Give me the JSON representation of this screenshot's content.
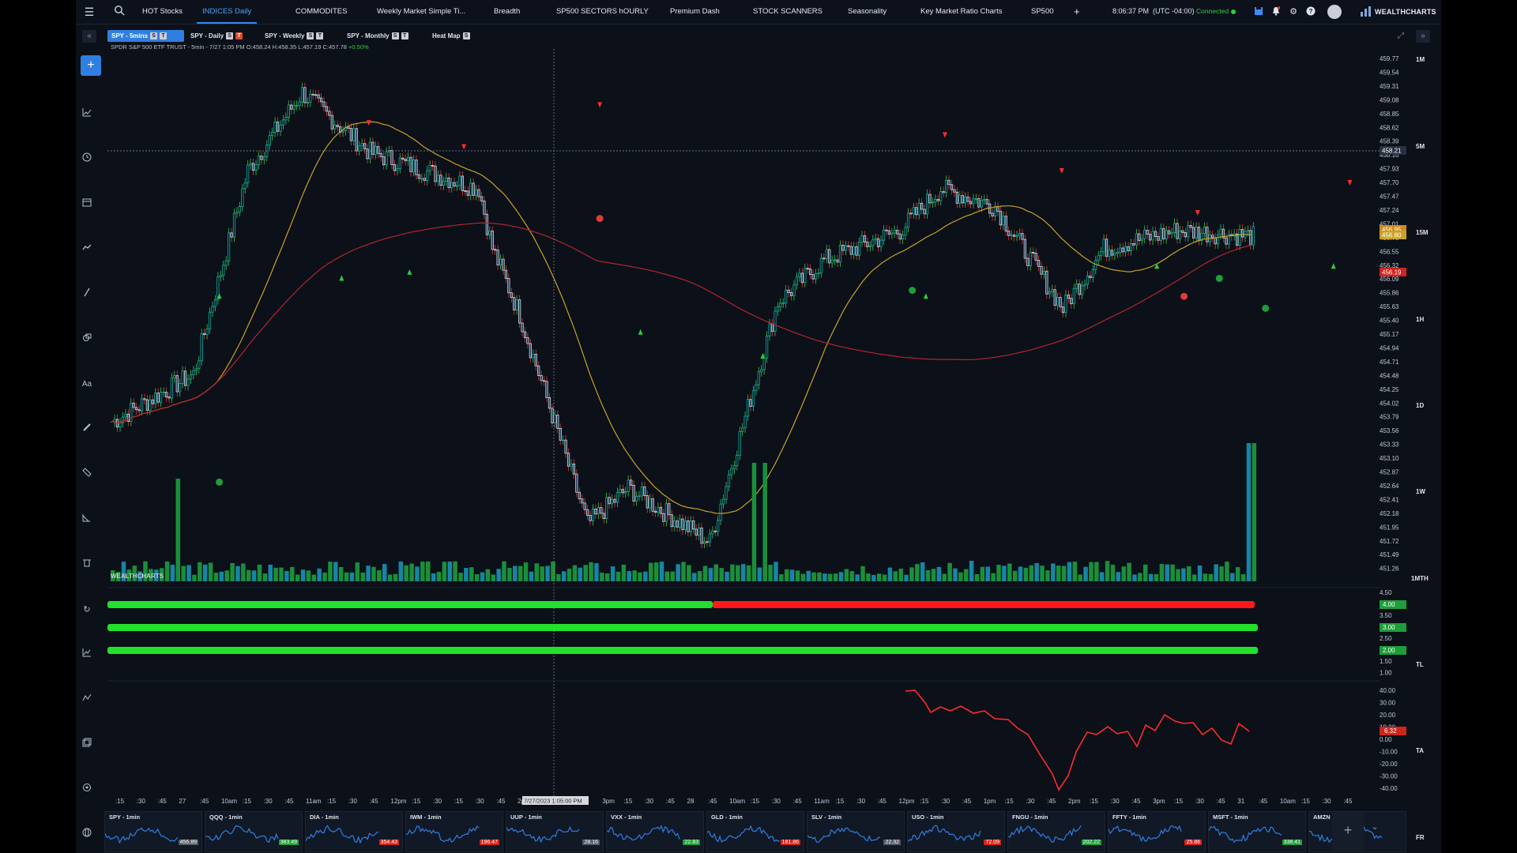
{
  "nav": {
    "tabs": [
      "HOT Stocks",
      "INDICES Daily",
      "COMMODITES",
      "Weekly Market Simple Ti...",
      "Breadth",
      "SP500 SECTORS hOURLY",
      "Premium Dash",
      "STOCK SCANNERS",
      "Seasonality",
      "Key Market Ratio Charts",
      "SP500"
    ],
    "active_tab": "INDICES Daily",
    "add_label": "+",
    "time": "8:06:37 PM",
    "timezone": "(UTC -04:00)",
    "status": "Connected",
    "brand": "WEALTHCHARTS"
  },
  "chart_tabs": [
    {
      "label": "SPY - 5mins",
      "badges": [
        "S",
        "T"
      ],
      "active": true
    },
    {
      "label": "SPY - Daily",
      "badges": [
        "S",
        "T"
      ],
      "active": false
    },
    {
      "label": "SPY - Weekly",
      "badges": [
        "S",
        "T"
      ],
      "active": false
    },
    {
      "label": "SPY - Monthly",
      "badges": [
        "S",
        "T"
      ],
      "active": false
    },
    {
      "label": "Heat Map",
      "badges": [
        "S"
      ],
      "active": false
    }
  ],
  "symbol": {
    "name": "SPDR S&P 500 ETF TRUST",
    "bar_info": "- 5min - 7/27 1:05 PM O:458.24 H:458.35 L:457.19 C:457.78",
    "change": "+0.50%"
  },
  "timeframes": [
    "1M",
    "5M",
    "15M",
    "1H",
    "1D",
    "1W",
    "1MTH",
    "TL",
    "TA",
    "FR"
  ],
  "price_axis": [
    "459.77",
    "459.54",
    "459.31",
    "459.08",
    "458.85",
    "458.62",
    "458.39",
    "458.16",
    "457.93",
    "457.70",
    "457.47",
    "457.24",
    "457.01",
    "456.78",
    "456.55",
    "456.32",
    "456.09",
    "455.86",
    "455.63",
    "455.40",
    "455.17",
    "454.94",
    "454.71",
    "454.48",
    "454.25",
    "454.02",
    "453.79",
    "453.56",
    "453.33",
    "453.10",
    "452.87",
    "452.64",
    "452.41",
    "452.18",
    "451.95",
    "451.72",
    "451.49",
    "451.26"
  ],
  "price_tags": {
    "crosshair": "458.21",
    "ma1": "456.95",
    "ma2": "456.80",
    "last": "456.19"
  },
  "indicator1_axis": [
    "4.50",
    "4.00",
    "3.50",
    "3.00",
    "2.50",
    "2.00",
    "1.50",
    "1.00"
  ],
  "indicator1_tags": [
    "4.00",
    "3.00",
    "2.00"
  ],
  "indicator2_axis": [
    "40.00",
    "30.00",
    "20.00",
    "10.00",
    "0.00",
    "-10.00",
    "-20.00",
    "-30.00",
    "-40.00"
  ],
  "indicator2_tag": "6.32",
  "time_axis": [
    ":15",
    ":30",
    ":45",
    "27",
    ":45",
    "10am",
    ":15",
    ":30",
    ":45",
    "11am",
    ":15",
    ":30",
    ":45",
    "12pm",
    ":15",
    ":30",
    ":15",
    ":30",
    ":45",
    "2pm",
    ":15",
    ":30",
    ":45",
    "3pm",
    ":15",
    ":30",
    ":45",
    "28",
    ":45",
    "10am",
    ":15",
    ":30",
    ":45",
    "11am",
    ":15",
    ":30",
    ":45",
    "12pm",
    ":15",
    ":30",
    ":45",
    "1pm",
    ":15",
    ":30",
    ":45",
    "2pm",
    ":15",
    ":30",
    ":45",
    "3pm",
    ":15",
    ":30",
    ":45",
    "31",
    ":45",
    "10am",
    ":15",
    ":30",
    ":45"
  ],
  "crosshair_time": "7/27/2023 1:05:00 PM",
  "watermark": "WEALTHCHARTS",
  "mini_charts": [
    {
      "title": "SPY - 1min",
      "price": "456.89",
      "color": "#555b66"
    },
    {
      "title": "QQQ - 1min",
      "price": "383.49",
      "color": "#1e9e3a"
    },
    {
      "title": "DIA - 1min",
      "price": "354.43",
      "color": "#d0241c"
    },
    {
      "title": "IWM - 1min",
      "price": "196.47",
      "color": "#d0241c"
    },
    {
      "title": "UUP - 1min",
      "price": "28.16",
      "color": "#555b66"
    },
    {
      "title": "VXX - 1min",
      "price": "22.83",
      "color": "#1e9e3a"
    },
    {
      "title": "GLD - 1min",
      "price": "181.86",
      "color": "#d0241c"
    },
    {
      "title": "SLV - 1min",
      "price": "22.32",
      "color": "#555b66"
    },
    {
      "title": "USO - 1min",
      "price": "72.09",
      "color": "#d0241c"
    },
    {
      "title": "FNGU - 1min",
      "price": "202.22",
      "color": "#1e9e3a"
    },
    {
      "title": "FFTY - 1min",
      "price": "25.86",
      "color": "#d0241c"
    },
    {
      "title": "MSFT - 1min",
      "price": "338.41",
      "color": "#1e9e3a"
    },
    {
      "title": "AMZN",
      "price": "",
      "color": "#555b66"
    }
  ],
  "colors": {
    "up": "#2ecc40",
    "down": "#ff2b2b",
    "ma_fast": "#c9a227",
    "ma_slow": "#b3262c",
    "accent": "#2f7fe0"
  }
}
